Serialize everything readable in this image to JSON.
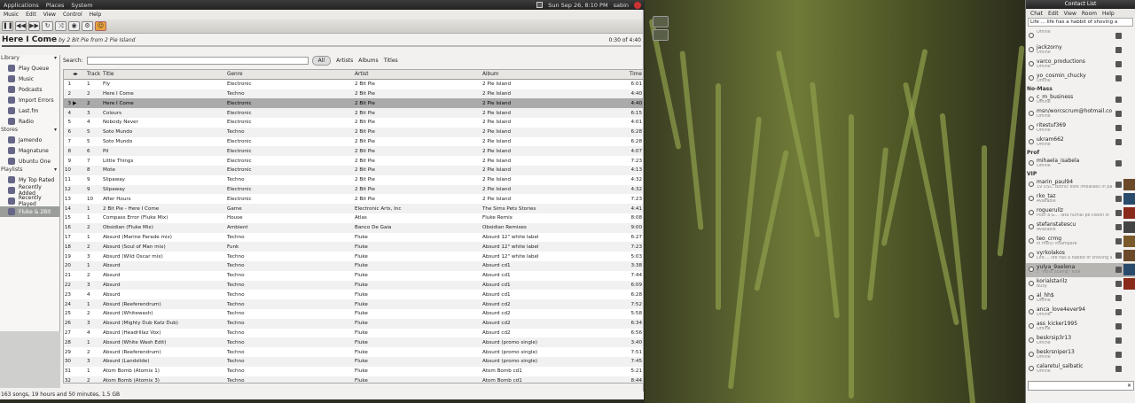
{
  "topbar": {
    "applications": "Applications",
    "places": "Places",
    "system": "System",
    "clock": "Sun Sep 26, 8:10 PM",
    "user": "sabin"
  },
  "menu": {
    "music": "Music",
    "edit": "Edit",
    "view": "View",
    "control": "Control",
    "help": "Help"
  },
  "now": {
    "title": "Here I Come",
    "by": "by 2 Bit Pie from 2 Pie Island",
    "elapsed": "0:30 of 4:40",
    "progress": 0.107
  },
  "sidebar": {
    "library": "Library",
    "stores": "Stores",
    "playlists": "Playlists",
    "lib_items": [
      "Play Queue",
      "Music",
      "Podcasts",
      "Import Errors",
      "Last.fm",
      "Radio"
    ],
    "store_items": [
      "Jamendo",
      "Magnatune",
      "Ubuntu One"
    ],
    "playlist_items": [
      "My Top Rated",
      "Recently Added",
      "Recently Played",
      "Fluke & 2Bit"
    ]
  },
  "search": {
    "label": "Search:",
    "filters": [
      "All",
      "Artists",
      "Albums",
      "Titles"
    ]
  },
  "table": {
    "headers": [
      "Track",
      "Title",
      "Genre",
      "Artist",
      "Album",
      "Time"
    ],
    "rows": [
      [
        "1",
        "1",
        "Fly",
        "Electronic",
        "2 Bit Pie",
        "2 Pie Island",
        "6:01"
      ],
      [
        "2",
        "2",
        "Here I Come",
        "Techno",
        "2 Bit Pie",
        "2 Pie Island",
        "4:40"
      ],
      [
        "3",
        "2",
        "Here I Come",
        "Electronic",
        "2 Bit Pie",
        "2 Pie Island",
        "4:40"
      ],
      [
        "4",
        "3",
        "Colours",
        "Electronic",
        "2 Bit Pie",
        "2 Pie Island",
        "6:15"
      ],
      [
        "5",
        "4",
        "Nobody Never",
        "Electronic",
        "2 Bit Pie",
        "2 Pie Island",
        "4:01"
      ],
      [
        "6",
        "5",
        "Soto Mundo",
        "Techno",
        "2 Bit Pie",
        "2 Pie Island",
        "6:28"
      ],
      [
        "7",
        "5",
        "Soto Mundo",
        "Electronic",
        "2 Bit Pie",
        "2 Pie Island",
        "6:28"
      ],
      [
        "8",
        "6",
        "Pil",
        "Electronic",
        "2 Bit Pie",
        "2 Pie Island",
        "4:07"
      ],
      [
        "9",
        "7",
        "Little Things",
        "Electronic",
        "2 Bit Pie",
        "2 Pie Island",
        "7:23"
      ],
      [
        "10",
        "8",
        "Mote",
        "Electronic",
        "2 Bit Pie",
        "2 Pie Island",
        "4:13"
      ],
      [
        "11",
        "9",
        "Slipaway",
        "Techno",
        "2 Bit Pie",
        "2 Pie Island",
        "4:32"
      ],
      [
        "12",
        "9",
        "Slipaway",
        "Electronic",
        "2 Bit Pie",
        "2 Pie Island",
        "4:32"
      ],
      [
        "13",
        "10",
        "After Hours",
        "Electronic",
        "2 Bit Pie",
        "2 Pie Island",
        "7:23"
      ],
      [
        "14",
        "1",
        "2 Bit Pie - Here I Come",
        "Game",
        "Electronic Arts, Inc",
        "The Sims Pets Stories",
        "4:41"
      ],
      [
        "15",
        "1",
        "Compass Error (Fluke Mix)",
        "House",
        "Atlas",
        "Fluke Remix",
        "8:08"
      ],
      [
        "16",
        "2",
        "Obsidian (Fluke Mix)",
        "Ambient",
        "Banco De Gaia",
        "Obsidian Remixes",
        "9:00"
      ],
      [
        "17",
        "1",
        "Absurd (Marine Parade mix)",
        "Techno",
        "Fluke",
        "Absurd 12\" white label",
        "6:27"
      ],
      [
        "18",
        "2",
        "Absurd (Soul of Man mix)",
        "Funk",
        "Fluke",
        "Absurd 12\" white label",
        "7:23"
      ],
      [
        "19",
        "3",
        "Absurd (Wild Oscar mix)",
        "Techno",
        "Fluke",
        "Absurd 12\" white label",
        "5:03"
      ],
      [
        "20",
        "1",
        "Absurd",
        "Techno",
        "Fluke",
        "Absurd cd1",
        "3:38"
      ],
      [
        "21",
        "2",
        "Absurd",
        "Techno",
        "Fluke",
        "Absurd cd1",
        "7:44"
      ],
      [
        "22",
        "3",
        "Absurd",
        "Techno",
        "Fluke",
        "Absurd cd1",
        "6:09"
      ],
      [
        "23",
        "4",
        "Absurd",
        "Techno",
        "Fluke",
        "Absurd cd1",
        "6:28"
      ],
      [
        "24",
        "1",
        "Absurd (Reeferendrum)",
        "Techno",
        "Fluke",
        "Absurd cd2",
        "7:52"
      ],
      [
        "25",
        "2",
        "Absurd (Whitewash)",
        "Techno",
        "Fluke",
        "Absurd cd2",
        "5:58"
      ],
      [
        "26",
        "3",
        "Absurd (Mighty Dub Katz Dub)",
        "Techno",
        "Fluke",
        "Absurd cd2",
        "6:34"
      ],
      [
        "27",
        "4",
        "Absurd (Headrillaz Vox)",
        "Techno",
        "Fluke",
        "Absurd cd2",
        "6:56"
      ],
      [
        "28",
        "1",
        "Absurd (White Wash Edit)",
        "Techno",
        "Fluke",
        "Absurd (promo single)",
        "3:40"
      ],
      [
        "29",
        "2",
        "Absurd (Reeferendrum)",
        "Techno",
        "Fluke",
        "Absurd (promo single)",
        "7:51"
      ],
      [
        "30",
        "3",
        "Absurd (Landslide)",
        "Techno",
        "Fluke",
        "Absurd (promo single)",
        "7:45"
      ],
      [
        "31",
        "1",
        "Atom Bomb (Atomix 1)",
        "Techno",
        "Fluke",
        "Atom Bomb cd1",
        "5:21"
      ],
      [
        "32",
        "2",
        "Atom Bomb (Atomix 3)",
        "Techno",
        "Fluke",
        "Atom Bomb cd1",
        "8:44"
      ]
    ]
  },
  "status": "163 songs, 19 hours and 50 minutes, 1.5 GB",
  "contacts": {
    "title": "Contact List",
    "menu": [
      "Chat",
      "Edit",
      "View",
      "Room",
      "Help"
    ],
    "status_msg": "Life ... life has a habbit of shoving a",
    "groups": [
      {
        "name": "",
        "items": [
          [
            "",
            "Offline"
          ],
          [
            "jackzorny",
            "Offline"
          ],
          [
            "varco_productions",
            "Offline"
          ],
          [
            "yo_cosmin_chucky",
            "Offline"
          ]
        ]
      },
      {
        "name": "No-Mass",
        "items": [
          [
            "c_m_business",
            "Offline"
          ],
          [
            "msn/worcscrum@hotmail.co.uk",
            "Offline"
          ],
          [
            "ritestuf369",
            "Offline"
          ],
          [
            "ukram662",
            "Offline"
          ]
        ]
      },
      {
        "name": "Prof",
        "items": [
          [
            "mihaela_isabela",
            "Offline"
          ]
        ]
      },
      {
        "name": "VIP",
        "items": [
          [
            "marin_paul94",
            "19 OSC: Botnic este imbatabil in pa"
          ],
          [
            "rko_taz",
            "Available"
          ],
          [
            "roguerullz",
            "Pour a G... Tata numai pe lisbon st"
          ],
          [
            "stefanstatescu",
            "Available"
          ],
          [
            "teo_crmg",
            "in msn// intampare"
          ],
          [
            "vyrkolakos",
            "Life ... life has a habbit of shoving a"
          ],
          [
            "yulya_9aelena",
            "♪ \"Holic scamp\" Kisa"
          ],
          [
            "korialstarilz",
            "Busy"
          ],
          [
            "al_hh$",
            "Offline"
          ],
          [
            "anca_love4ever94",
            "Offline"
          ],
          [
            "ass_kicker1995",
            "Offline"
          ],
          [
            "beskrsip3r13",
            "Offline"
          ],
          [
            "beskrsniper13",
            "Offline"
          ],
          [
            "calaretul_salbatic",
            "Offline"
          ]
        ]
      }
    ]
  }
}
